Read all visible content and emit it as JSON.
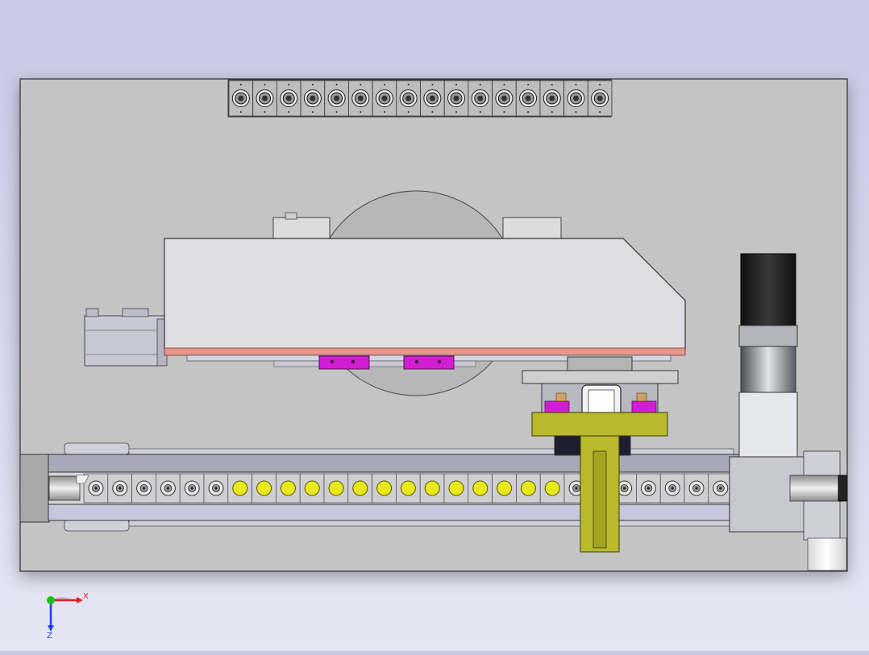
{
  "view": {
    "background_top": "#c9c9e6",
    "background_bottom": "#e6e6f3",
    "plate_color": "#c4c4c4",
    "part_colors": {
      "yellow": "#e8e81c",
      "olive": "#b9b92e",
      "magenta": "#d21ed2",
      "salmon": "#e6968c",
      "steel": "#a8a8b8",
      "light_steel": "#c6c6dc",
      "motor_body": "#2a2a2a"
    }
  },
  "triad": {
    "x_label": "X",
    "z_label": "Z",
    "x_color": "#e21d1d",
    "y_color": "#1dbf1d",
    "z_color": "#1d3fe2"
  },
  "top_rail": {
    "holder_count": 16
  },
  "conveyor": {
    "roller_states": [
      "grey",
      "grey",
      "grey",
      "grey",
      "grey",
      "grey",
      "yellow",
      "yellow",
      "yellow",
      "yellow",
      "yellow",
      "yellow",
      "yellow",
      "yellow",
      "yellow",
      "yellow",
      "yellow",
      "yellow",
      "yellow",
      "yellow",
      "grey",
      "grey",
      "grey",
      "grey",
      "grey",
      "grey",
      "grey",
      "grey",
      "grey"
    ]
  }
}
